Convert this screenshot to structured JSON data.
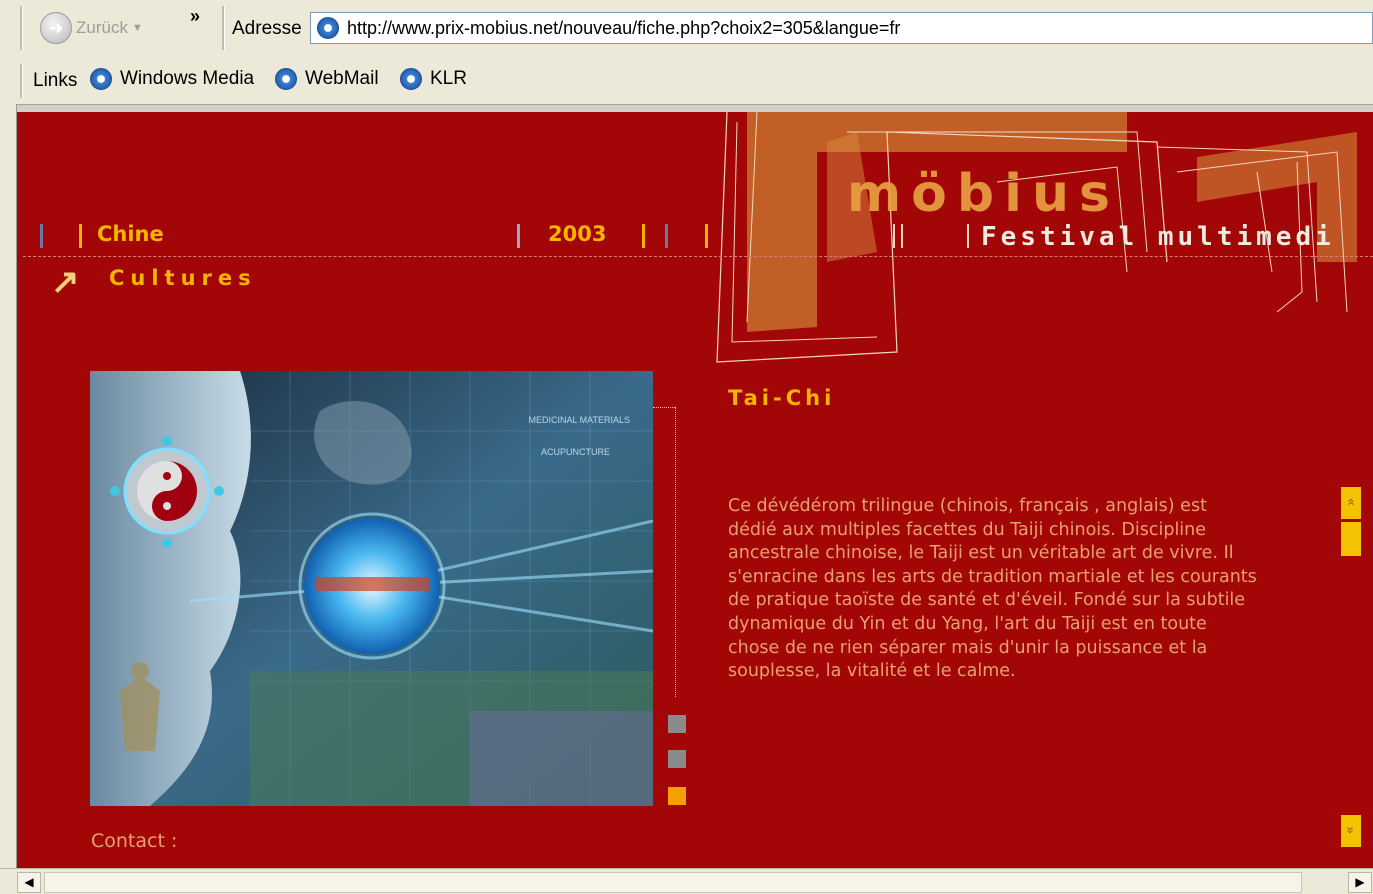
{
  "browser": {
    "back_label": "Zurück",
    "more_glyph": "»",
    "address_label": "Adresse",
    "address_url": "http://www.prix-mobius.net/nouveau/fiche.php?choix2=305&langue=fr",
    "links_label": "Links",
    "links": [
      {
        "label": "Windows Media",
        "icon": "ie-page-icon"
      },
      {
        "label": "WebMail",
        "icon": "ie-page-icon"
      },
      {
        "label": "KLR",
        "icon": "ie-page-icon"
      }
    ]
  },
  "page": {
    "logo_text": "möbius",
    "festival_text": "Festival multimedi",
    "nav": {
      "country": "Chine",
      "year": "2003"
    },
    "section": {
      "arrow_glyph": "↗",
      "title": "Cultures"
    },
    "item": {
      "title": "Tai-Chi",
      "description": "Ce dévédérom trilingue (chinois, français , anglais) est dédié aux multiples facettes du Taiji chinois. Discipline ancestrale chinoise, le Taiji est un véritable art de vivre. Il s'enracine dans les arts de tradition martiale et les courants de pratique taoïste de santé et d'éveil. Fondé sur la subtile dynamique du Yin et du Yang, l'art du Taiji est en toute chose de ne rien séparer mais d'unir la puissance et la souplesse, la vitalité et le calme."
    },
    "hero_labels": {
      "line1": "MEDICINAL MATERIALS",
      "line2": "ACUPUNCTURE"
    },
    "contact_label": "Contact :",
    "scroll_up_glyph": "»",
    "scroll_down_glyph": "»"
  },
  "colors": {
    "page_bg": "#a30606",
    "accent_yellow": "#f5b400",
    "text_orange": "#e9a070",
    "logo_orange": "#e8a040"
  }
}
